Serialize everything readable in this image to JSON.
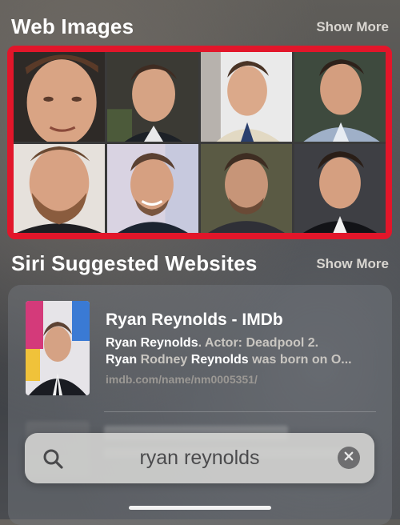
{
  "web_images": {
    "title": "Web Images",
    "show_more": "Show More",
    "highlight_color": "#e2162a"
  },
  "siri_websites": {
    "title": "Siri Suggested Websites",
    "show_more": "Show More",
    "result": {
      "title": "Ryan Reynolds - IMDb",
      "desc_hl_1": "Ryan Reynolds",
      "desc_part_1": ". Actor: Deadpool 2.",
      "desc_hl_2": "Ryan",
      "desc_part_2": " Rodney ",
      "desc_hl_3": "Reynolds",
      "desc_part_3": " was born on O...",
      "url": "imdb.com/name/nm0005351/"
    }
  },
  "search": {
    "query": "ryan reynolds",
    "icon": "search-icon",
    "clear_icon": "clear-icon"
  }
}
